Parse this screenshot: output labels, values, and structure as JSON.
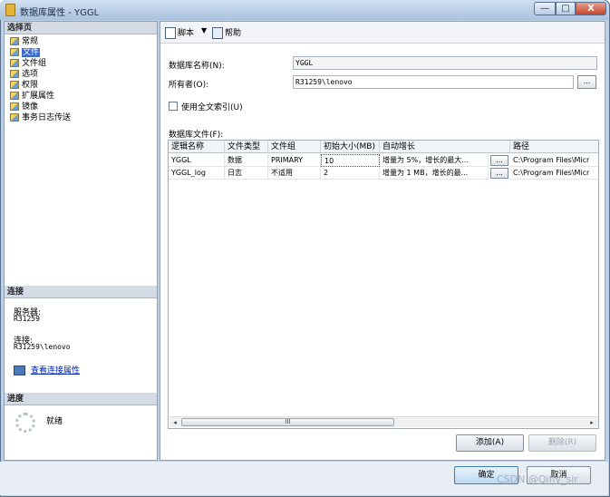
{
  "window": {
    "title": "数据库属性 - YGGL",
    "min_glyph": "—",
    "max_glyph": "□",
    "close_glyph": "X"
  },
  "left": {
    "select_page_header": "选择页",
    "pages": [
      "常规",
      "文件",
      "文件组",
      "选项",
      "权限",
      "扩展属性",
      "镜像",
      "事务日志传送"
    ],
    "selected_page": "文件",
    "connection_header": "连接",
    "server_label": "服务器:",
    "server_value": "R31259",
    "connection_label": "连接:",
    "connection_value": "R31259\\lenovo",
    "view_connection_link": "查看连接属性",
    "progress_header": "进度",
    "progress_status": "就绪"
  },
  "toolbar": {
    "script_label": "脚本",
    "dropdown_glyph": "▼",
    "help_label": "帮助"
  },
  "form": {
    "db_name_label": "数据库名称(N):",
    "db_name_value": "YGGL",
    "owner_label": "所有者(O):",
    "owner_value": "R31259\\lenovo",
    "browse_label": "...",
    "fulltext_label": "使用全文索引(U)",
    "fulltext_checked": false,
    "db_files_label": "数据库文件(F):"
  },
  "grid": {
    "columns": [
      "逻辑名称",
      "文件类型",
      "文件组",
      "初始大小(MB)",
      "自动增长",
      "路径"
    ],
    "rows": [
      {
        "logical_name": "YGGL",
        "file_type": "数据",
        "filegroup": "PRIMARY",
        "initial_size": "10",
        "autogrowth": "增量为 5%，增长的最大...",
        "path": "C:\\Program Files\\Micr"
      },
      {
        "logical_name": "YGGL_log",
        "file_type": "日志",
        "filegroup": "不适用",
        "initial_size": "2",
        "autogrowth": "增量为 1 MB，增长的最...",
        "path": "C:\\Program Files\\Micr"
      }
    ],
    "cell_button": "...",
    "scroll_left": "◂",
    "scroll_right": "▸",
    "thumb_grip": "III"
  },
  "buttons": {
    "add": "添加(A)",
    "remove": "删除(R)",
    "ok": "确定",
    "cancel": "取消"
  },
  "watermark": "CSDN @Qifiy_sir"
}
